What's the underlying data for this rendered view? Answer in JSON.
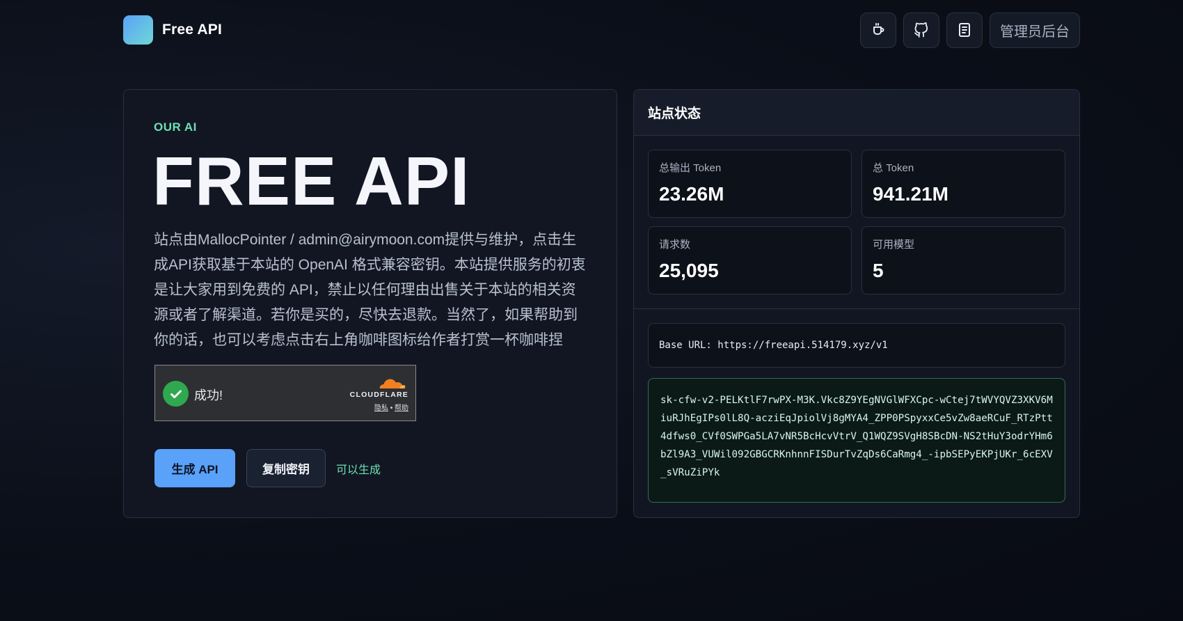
{
  "header": {
    "brand_name": "Free API",
    "nav_icons": [
      "coffee-icon",
      "github-icon",
      "docs-icon"
    ],
    "admin_label": "管理员后台"
  },
  "hero": {
    "eyebrow": "OUR AI",
    "title": "FREE API",
    "description": "站点由MallocPointer / admin@airymoon.com提供与维护，点击生成API获取基于本站的 OpenAI 格式兼容密钥。本站提供服务的初衷是让大家用到免费的 API，禁止以任何理由出售关于本站的相关资源或者了解渠道。若你是买的，尽快去退款。当然了，如果帮助到你的话，也可以考虑点击右上角咖啡图标给作者打赏一杯咖啡捏",
    "captcha": {
      "status_text": "成功!",
      "provider": "CLOUDFLARE",
      "privacy_link": "隐私",
      "separator": "•",
      "help_link": "帮助"
    },
    "generate_label": "生成 API",
    "copy_label": "复制密钥",
    "status_note": "可以生成"
  },
  "status": {
    "title": "站点状态",
    "stats": [
      {
        "label": "总输出 Token",
        "value": "23.26M"
      },
      {
        "label": "总 Token",
        "value": "941.21M"
      },
      {
        "label": "请求数",
        "value": "25,095"
      },
      {
        "label": "可用模型",
        "value": "5"
      }
    ],
    "base_url": "Base URL: https://freeapi.514179.xyz/v1",
    "api_key": "sk-cfw-v2-PELKtlF7rwPX-M3K.Vkc8Z9YEgNVGlWFXCpc-wCtej7tWVYQVZ3XKV6MiuRJhEgIPs0lL8Q-acziEqJpiolVj8gMYA4_ZPP0PSpyxxCe5vZw8aeRCuF_RTzPtt4dfws0_CVf0SWPGa5LA7vNR5BcHcvVtrV_Q1WQZ9SVgH8SBcDN-NS2tHuY3odrYHm6bZl9A3_VUWil092GBGCRKnhnnFISDurTvZqDs6CaRmg4_-ipbSEPyEKPjUKr_6cEXV_sVRuZiPYk"
  },
  "colors": {
    "accent_green": "#6ee0b6",
    "primary_blue": "#5aa1fa",
    "background": "#0b0f19",
    "card": "#111622"
  }
}
